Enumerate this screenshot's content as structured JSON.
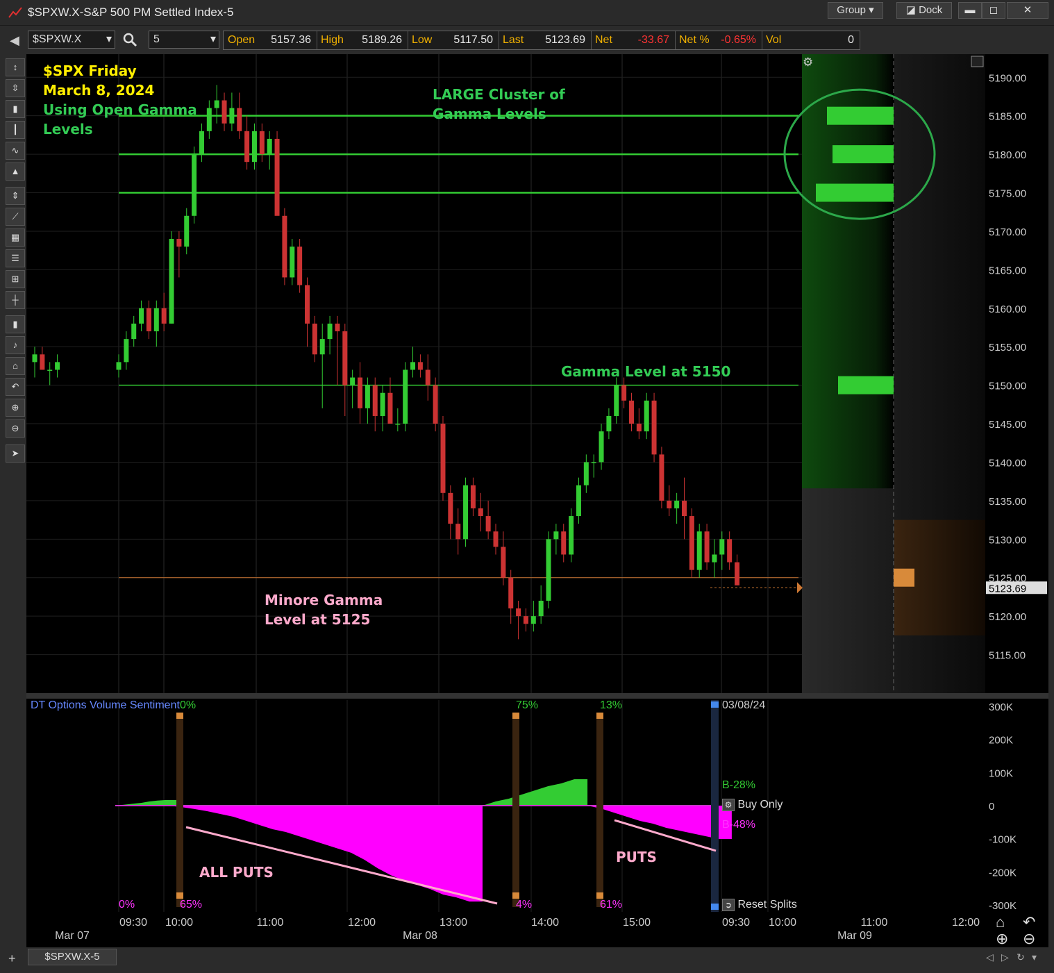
{
  "window": {
    "title": "$SPXW.X-S&P 500 PM Settled Index-5",
    "group_label": "Group",
    "dock_label": "Dock",
    "minimize": "▬",
    "maximize": "◻",
    "close": "✕"
  },
  "toolbar": {
    "symbol": "$SPXW.X",
    "interval": "5",
    "quote": [
      {
        "label": "Open",
        "value": "5157.36",
        "value_color": "#e6e6e6"
      },
      {
        "label": "High",
        "value": "5189.26",
        "value_color": "#e6e6e6"
      },
      {
        "label": "Low",
        "value": "5117.50",
        "value_color": "#e6e6e6"
      },
      {
        "label": "Last",
        "value": "5123.69",
        "value_color": "#e6e6e6"
      },
      {
        "label": "Net",
        "value": "-33.67",
        "value_color": "#ff3333"
      },
      {
        "label": "Net %",
        "value": "-0.65%",
        "value_color": "#ff3333"
      },
      {
        "label": "Vol",
        "value": "0",
        "value_color": "#e6e6e6"
      }
    ]
  },
  "annotations": {
    "title_line1": "$SPX Friday",
    "title_line2": "March 8, 2024",
    "subtitle_line1": "Using Open Gamma",
    "subtitle_line2": "Levels",
    "cluster_line1": "LARGE Cluster of",
    "cluster_line2": "Gamma Levels",
    "gamma_5150": "Gamma Level at 5150",
    "minor_line1": "Minore Gamma",
    "minor_line2": "Level at 5125",
    "all_puts": "ALL PUTS",
    "puts": "PUTS"
  },
  "colors": {
    "up": "#33cc33",
    "down": "#cc3333",
    "gamma_line": "#33cc33",
    "minor_line": "#cc7733",
    "call_area": "#33cc33",
    "put_area": "#ff00ff",
    "annotation_yellow": "#ffee00",
    "annotation_green": "#33cc55",
    "annotation_pink": "#ffaacc"
  },
  "lower_panel": {
    "title": "DT Options Volume Sentiment",
    "date_label": "03/08/24",
    "b_call": "B-28%",
    "b_put": "B-48%",
    "buy_only": "Buy Only",
    "reset_splits": "Reset Splits",
    "splits": [
      {
        "top": "0%",
        "bottom": "65%"
      },
      {
        "top": "75%",
        "bottom": "4%"
      },
      {
        "top": "13%",
        "bottom": "61%"
      }
    ],
    "left_bottom": "0%"
  },
  "x_axis": {
    "times": [
      "09:30",
      "10:00",
      "11:00",
      "12:00",
      "13:00",
      "14:00",
      "15:00",
      "09:30",
      "10:00",
      "11:00",
      "12:00"
    ],
    "dates": [
      "Mar 07",
      "Mar 08",
      "Mar 09"
    ]
  },
  "bottom": {
    "tab_label": "$SPXW.X-5"
  },
  "chart_data": [
    {
      "type": "candlestick",
      "interval_minutes": 5,
      "ylim": [
        5110,
        5193
      ],
      "y_ticks": [
        "5190.00",
        "5185.00",
        "5180.00",
        "5175.00",
        "5170.00",
        "5165.00",
        "5160.00",
        "5155.00",
        "5150.00",
        "5145.00",
        "5140.00",
        "5135.00",
        "5130.00",
        "5125.00",
        "5120.00",
        "5115.00"
      ],
      "last_price": "5123.69",
      "gamma_levels": [
        {
          "price": 5185,
          "strength": 0.6
        },
        {
          "price": 5180,
          "strength": 0.55
        },
        {
          "price": 5175,
          "strength": 0.7
        },
        {
          "price": 5150,
          "strength": 0.5
        }
      ],
      "minor_gamma_level": {
        "price": 5125,
        "strength": 0.2
      },
      "candles_prior_day": [
        [
          5153,
          5155,
          5151,
          5154
        ],
        [
          5154,
          5155,
          5152,
          5152
        ],
        [
          5152,
          5153,
          5150,
          5152
        ],
        [
          5152,
          5154,
          5151,
          5153
        ]
      ],
      "candles": [
        [
          5152,
          5154,
          5151,
          5153
        ],
        [
          5153,
          5157,
          5152,
          5156
        ],
        [
          5156,
          5159,
          5155,
          5158
        ],
        [
          5158,
          5161,
          5157,
          5160
        ],
        [
          5160,
          5161,
          5156,
          5157
        ],
        [
          5157,
          5161,
          5155,
          5160
        ],
        [
          5160,
          5162,
          5157,
          5158
        ],
        [
          5158,
          5170,
          5158,
          5169
        ],
        [
          5169,
          5170,
          5164,
          5168
        ],
        [
          5168,
          5173,
          5167,
          5172
        ],
        [
          5172,
          5181,
          5171,
          5180
        ],
        [
          5180,
          5184,
          5179,
          5183
        ],
        [
          5183,
          5187,
          5182,
          5186
        ],
        [
          5186,
          5189,
          5184,
          5187
        ],
        [
          5187,
          5188,
          5183,
          5184
        ],
        [
          5184,
          5188,
          5183,
          5186
        ],
        [
          5186,
          5188,
          5182,
          5183
        ],
        [
          5183,
          5185,
          5178,
          5179
        ],
        [
          5179,
          5184,
          5178,
          5183
        ],
        [
          5183,
          5184,
          5179,
          5180
        ],
        [
          5180,
          5183,
          5178,
          5182
        ],
        [
          5182,
          5183,
          5176,
          5172
        ],
        [
          5172,
          5173,
          5163,
          5164
        ],
        [
          5164,
          5169,
          5163,
          5168
        ],
        [
          5168,
          5169,
          5162,
          5163
        ],
        [
          5163,
          5164,
          5155,
          5158
        ],
        [
          5158,
          5159,
          5153,
          5154
        ],
        [
          5154,
          5158,
          5147,
          5156
        ],
        [
          5156,
          5159,
          5154,
          5158
        ],
        [
          5158,
          5159,
          5150,
          5157
        ],
        [
          5157,
          5158,
          5146,
          5150
        ],
        [
          5150,
          5152,
          5147,
          5151
        ],
        [
          5151,
          5153,
          5145,
          5147
        ],
        [
          5147,
          5151,
          5145,
          5150
        ],
        [
          5150,
          5151,
          5144,
          5146
        ],
        [
          5146,
          5150,
          5144,
          5149
        ],
        [
          5149,
          5151,
          5145,
          5145
        ],
        [
          5145,
          5147,
          5144,
          5145
        ],
        [
          5145,
          5153,
          5144,
          5152
        ],
        [
          5152,
          5155,
          5151,
          5153
        ],
        [
          5153,
          5154,
          5151,
          5152
        ],
        [
          5152,
          5154,
          5148,
          5150
        ],
        [
          5150,
          5151,
          5144,
          5145
        ],
        [
          5145,
          5146,
          5135,
          5136
        ],
        [
          5136,
          5137,
          5130,
          5132
        ],
        [
          5132,
          5134,
          5128,
          5130
        ],
        [
          5130,
          5138,
          5129,
          5137
        ],
        [
          5137,
          5138,
          5133,
          5134
        ],
        [
          5134,
          5136,
          5131,
          5133
        ],
        [
          5133,
          5135,
          5130,
          5131
        ],
        [
          5131,
          5132,
          5128,
          5129
        ],
        [
          5129,
          5131,
          5124,
          5125
        ],
        [
          5125,
          5126,
          5119,
          5121
        ],
        [
          5121,
          5122,
          5117,
          5120
        ],
        [
          5120,
          5121,
          5118,
          5119
        ],
        [
          5119,
          5122,
          5118,
          5120
        ],
        [
          5120,
          5124,
          5119,
          5122
        ],
        [
          5122,
          5131,
          5121,
          5130
        ],
        [
          5130,
          5132,
          5128,
          5131
        ],
        [
          5131,
          5132,
          5127,
          5128
        ],
        [
          5128,
          5134,
          5127,
          5133
        ],
        [
          5133,
          5138,
          5132,
          5137
        ],
        [
          5137,
          5141,
          5136,
          5140
        ],
        [
          5140,
          5141,
          5138,
          5140
        ],
        [
          5140,
          5145,
          5139,
          5144
        ],
        [
          5144,
          5147,
          5143,
          5146
        ],
        [
          5146,
          5151,
          5145,
          5150
        ],
        [
          5150,
          5151,
          5147,
          5148
        ],
        [
          5148,
          5149,
          5144,
          5145
        ],
        [
          5145,
          5147,
          5143,
          5144
        ],
        [
          5144,
          5149,
          5143,
          5148
        ],
        [
          5148,
          5149,
          5140,
          5141
        ],
        [
          5141,
          5142,
          5134,
          5135
        ],
        [
          5135,
          5137,
          5133,
          5134
        ],
        [
          5134,
          5136,
          5132,
          5135
        ],
        [
          5135,
          5138,
          5130,
          5133
        ],
        [
          5133,
          5134,
          5125,
          5126
        ],
        [
          5126,
          5132,
          5125,
          5131
        ],
        [
          5131,
          5132,
          5126,
          5127
        ],
        [
          5127,
          5130,
          5125,
          5128
        ],
        [
          5128,
          5131,
          5126,
          5130
        ],
        [
          5130,
          5131,
          5126,
          5127
        ],
        [
          5127,
          5128,
          5124,
          5124
        ]
      ]
    },
    {
      "type": "area",
      "title": "DT Options Volume Sentiment",
      "y_ticks": [
        "300K",
        "200K",
        "100K",
        "0",
        "-100K",
        "-200K",
        "-300K"
      ],
      "ylim": [
        -400,
        400
      ],
      "units": "K",
      "series": [
        {
          "name": "calls",
          "color": "#33cc33",
          "points": [
            [
              0,
              0
            ],
            [
              0.02,
              2
            ],
            [
              0.05,
              5
            ],
            [
              0.08,
              8
            ],
            [
              0.1,
              10
            ],
            [
              0.13,
              15
            ],
            [
              0.16,
              18
            ],
            [
              0.19,
              20
            ]
          ]
        },
        {
          "name": "puts",
          "color": "#ff00ff",
          "points": [
            [
              0.2,
              0
            ],
            [
              0.25,
              -5
            ],
            [
              0.3,
              -12
            ],
            [
              0.35,
              -20
            ],
            [
              0.4,
              -30
            ],
            [
              0.45,
              -40
            ],
            [
              0.5,
              -55
            ],
            [
              0.55,
              -70
            ],
            [
              0.6,
              -85
            ],
            [
              0.65,
              -95
            ],
            [
              0.7,
              -110
            ],
            [
              0.75,
              -125
            ],
            [
              0.8,
              -140
            ],
            [
              0.85,
              -155
            ],
            [
              0.9,
              -170
            ],
            [
              0.95,
              -195
            ],
            [
              1.0,
              -225
            ],
            [
              1.05,
              -250
            ],
            [
              1.1,
              -270
            ],
            [
              1.15,
              -285
            ],
            [
              1.2,
              -300
            ],
            [
              1.25,
              -320
            ],
            [
              1.3,
              -330
            ],
            [
              1.35,
              -345
            ]
          ]
        },
        {
          "name": "calls2",
          "color": "#33cc33",
          "points": [
            [
              1.4,
              0
            ],
            [
              1.45,
              15
            ],
            [
              1.5,
              25
            ],
            [
              1.55,
              40
            ],
            [
              1.6,
              55
            ],
            [
              1.65,
              70
            ],
            [
              1.7,
              80
            ],
            [
              1.75,
              95
            ]
          ]
        },
        {
          "name": "puts2",
          "color": "#ff00ff",
          "points": [
            [
              1.8,
              0
            ],
            [
              1.85,
              -10
            ],
            [
              1.9,
              -25
            ],
            [
              1.95,
              -40
            ],
            [
              2.0,
              -55
            ],
            [
              2.05,
              -65
            ],
            [
              2.1,
              -80
            ],
            [
              2.15,
              -90
            ],
            [
              2.2,
              -100
            ],
            [
              2.25,
              -110
            ],
            [
              2.3,
              -120
            ]
          ]
        }
      ]
    }
  ]
}
